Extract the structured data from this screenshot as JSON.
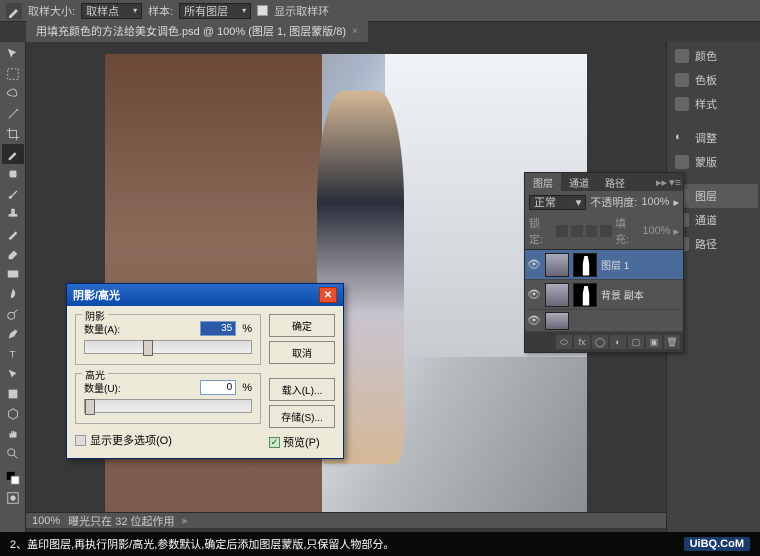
{
  "topbar": {
    "sample_size_label": "取样大小:",
    "sample_size_value": "取样点",
    "sample_label": "样本:",
    "sample_value": "所有图层",
    "show_sample_label": "显示取样环"
  },
  "doc_tab": {
    "title": "用填充颜色的方法给美女调色.psd @ 100% (图层 1, 图层蒙版/8)",
    "close": "×"
  },
  "layers_panel": {
    "tabs": [
      "图层",
      "通道",
      "路径"
    ],
    "blend_mode": "正常",
    "opacity_label": "不透明度:",
    "opacity_value": "100%",
    "lock_label": "锁定:",
    "fill_label": "填充:",
    "fill_value": "100%",
    "layers": [
      {
        "name": "图层 1",
        "selected": true,
        "has_mask": true,
        "visible": true
      },
      {
        "name": "背景 副本",
        "selected": false,
        "has_mask": true,
        "visible": true
      },
      {
        "name": "",
        "selected": false,
        "has_mask": false,
        "visible": true
      }
    ]
  },
  "right_panel": {
    "items": [
      "颜色",
      "色板",
      "样式",
      "调整",
      "蒙版",
      "图层",
      "通道",
      "路径"
    ]
  },
  "dialog": {
    "title": "阴影/高光",
    "shadow_group": "阴影",
    "highlight_group": "高光",
    "amount_label_s": "数量(A):",
    "amount_label_h": "数量(U):",
    "shadow_value": "35",
    "highlight_value": "0",
    "percent": "%",
    "more_options": "显示更多选项(O)",
    "ok": "确定",
    "cancel": "取消",
    "load": "载入(L)...",
    "save": "存储(S)...",
    "preview": "预览(P)"
  },
  "status": {
    "zoom": "100%",
    "info": "曝光只在 32 位起作用"
  },
  "caption": {
    "text": "2、盖印图层,再执行阴影/高光,参数默认,确定后添加图层蒙版,只保留人物部分。",
    "watermark": "UiBQ.CoM"
  }
}
